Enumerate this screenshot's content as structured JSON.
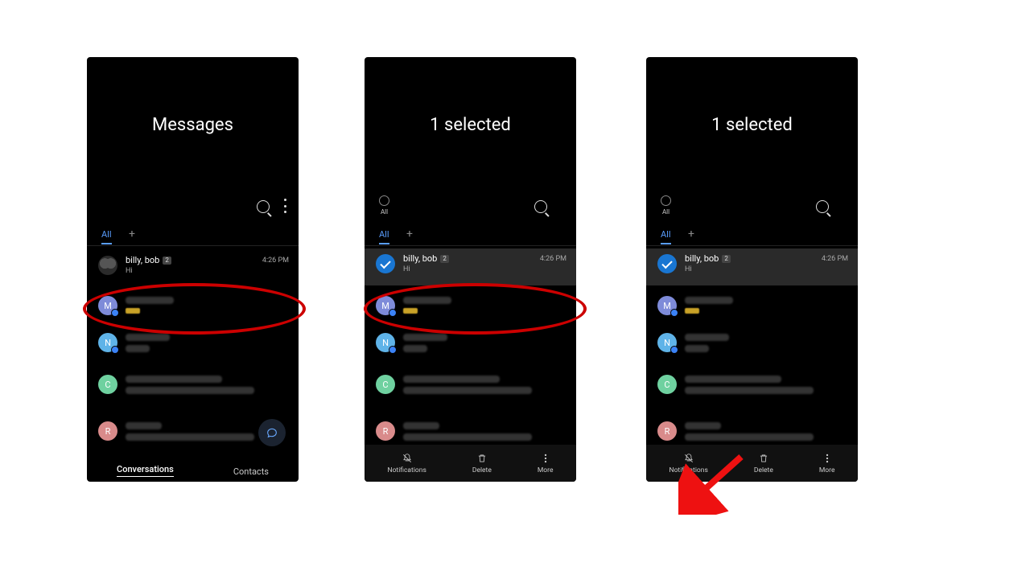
{
  "screens": {
    "s1": {
      "title": "Messages",
      "tab_all": "All",
      "conv": {
        "name": "billy, bob",
        "badge": "2",
        "preview": "Hi",
        "time": "4:26 PM"
      },
      "bottom": {
        "conversations": "Conversations",
        "contacts": "Contacts"
      },
      "avatars": {
        "row2": {
          "letter": "M",
          "color": "#7e8bd9"
        },
        "row3": {
          "letter": "N",
          "color": "#5fb3e8"
        },
        "row4": {
          "letter": "C",
          "color": "#6fd1a0"
        },
        "row5": {
          "letter": "R",
          "color": "#d98b8b"
        }
      }
    },
    "s2": {
      "title": "1 selected",
      "select_all": "All",
      "tab_all": "All",
      "conv": {
        "name": "billy, bob",
        "badge": "2",
        "preview": "Hi",
        "time": "4:26 PM"
      },
      "actions": {
        "notifications": "Notifications",
        "delete": "Delete",
        "more": "More"
      },
      "avatars": {
        "row2": {
          "letter": "M",
          "color": "#7e8bd9"
        },
        "row3": {
          "letter": "N",
          "color": "#5fb3e8"
        },
        "row4": {
          "letter": "C",
          "color": "#6fd1a0"
        },
        "row5": {
          "letter": "R",
          "color": "#d98b8b"
        }
      }
    },
    "s3": {
      "title": "1 selected",
      "select_all": "All",
      "tab_all": "All",
      "conv": {
        "name": "billy, bob",
        "badge": "2",
        "preview": "Hi",
        "time": "4:26 PM"
      },
      "actions": {
        "notifications": "Notifications",
        "delete": "Delete",
        "more": "More"
      },
      "avatars": {
        "row2": {
          "letter": "M",
          "color": "#7e8bd9"
        },
        "row3": {
          "letter": "N",
          "color": "#5fb3e8"
        },
        "row4": {
          "letter": "C",
          "color": "#6fd1a0"
        },
        "row5": {
          "letter": "R",
          "color": "#d98b8b"
        }
      }
    }
  }
}
